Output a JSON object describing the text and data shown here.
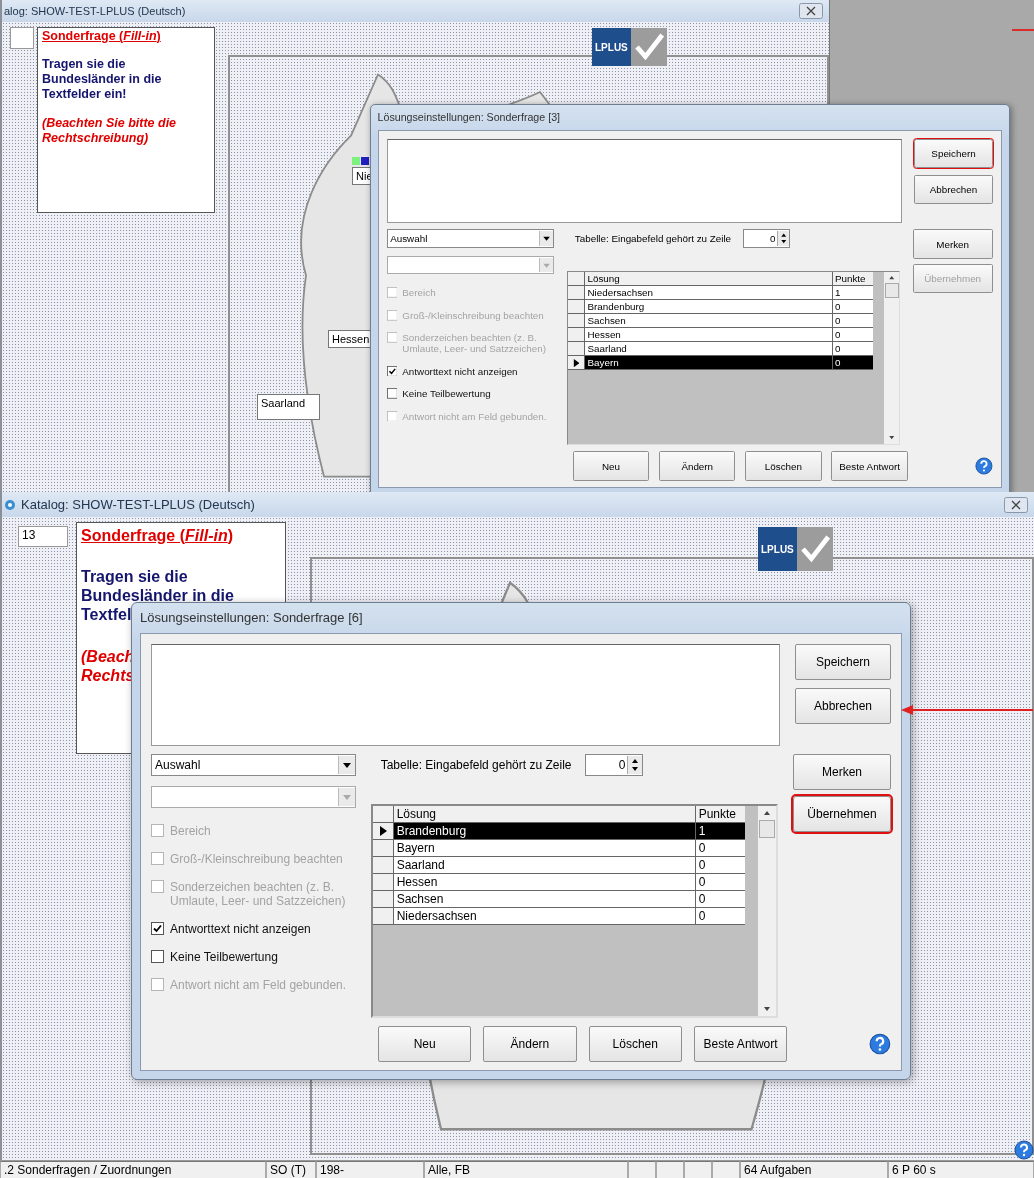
{
  "screens": [
    {
      "kind": "top",
      "title": "alog: SHOW-TEST-LPLUS (Deutsch)",
      "question": {
        "heading": "Sonderfrage (*Fill-in*)",
        "body": [
          "Tragen sie die",
          "Bundesländer in die",
          "Textfelder ein!"
        ],
        "note": [
          "(Beachten Sie bitte die",
          "Rechtschreibung)"
        ]
      },
      "logo": "LPLUS",
      "map_labels": [
        "Nie",
        "Hessen",
        "Saarland"
      ],
      "dialog": {
        "title": "Lösungseinstellungen: Sonderfrage [3]",
        "top_buttons": [
          {
            "label": "Speichern",
            "highlighted": true
          },
          {
            "label": "Abbrechen",
            "highlighted": false
          }
        ],
        "combo": "Auswahl",
        "row_label": "Tabelle: Eingabefeld gehört zu Zeile",
        "row_value": "0",
        "options": [
          {
            "label": "Bereich",
            "checked": false,
            "disabled": true
          },
          {
            "label": "Groß-/Kleinschreibung beachten",
            "checked": false,
            "disabled": true
          },
          {
            "label": "Sonderzeichen beachten (z. B. Umlaute, Leer- und Satzzeichen)",
            "checked": false,
            "disabled": true
          },
          {
            "label": "Antworttext nicht anzeigen",
            "checked": true,
            "disabled": false
          },
          {
            "label": "Keine Teilbewertung",
            "checked": false,
            "disabled": false
          },
          {
            "label": "Antwort nicht am Feld gebunden.",
            "checked": false,
            "disabled": true
          }
        ],
        "table": {
          "columns": [
            "Lösung",
            "Punkte"
          ],
          "rows": [
            {
              "cells": [
                "Niedersachsen",
                "1"
              ],
              "selected": false
            },
            {
              "cells": [
                "Brandenburg",
                "0"
              ],
              "selected": false
            },
            {
              "cells": [
                "Sachsen",
                "0"
              ],
              "selected": false
            },
            {
              "cells": [
                "Hessen",
                "0"
              ],
              "selected": false
            },
            {
              "cells": [
                "Saarland",
                "0"
              ],
              "selected": false
            },
            {
              "cells": [
                "Bayern",
                "0"
              ],
              "selected": true
            }
          ]
        },
        "side_buttons": [
          {
            "label": "Merken",
            "disabled": false,
            "highlighted": false
          },
          {
            "label": "Übernehmen",
            "disabled": true,
            "highlighted": false
          }
        ],
        "bottom_buttons": [
          "Neu",
          "Ändern",
          "Löschen",
          "Beste Antwort"
        ]
      }
    },
    {
      "kind": "bottom",
      "title": "Katalog: SHOW-TEST-LPLUS (Deutsch)",
      "number": "13",
      "question": {
        "heading": "Sonderfrage (*Fill-in*)",
        "body": [
          "Tragen sie die",
          "Bundesländer in die",
          "Textfel"
        ],
        "note": [
          "(Beach",
          "Rechts"
        ]
      },
      "logo": "LPLUS",
      "dialog": {
        "title": "Lösungseinstellungen: Sonderfrage [6]",
        "top_buttons": [
          {
            "label": "Speichern",
            "highlighted": false
          },
          {
            "label": "Abbrechen",
            "highlighted": false
          }
        ],
        "combo": "Auswahl",
        "row_label": "Tabelle: Eingabefeld gehört zu Zeile",
        "row_value": "0",
        "options": [
          {
            "label": "Bereich",
            "checked": false,
            "disabled": true
          },
          {
            "label": "Groß-/Kleinschreibung beachten",
            "checked": false,
            "disabled": true
          },
          {
            "label": "Sonderzeichen beachten (z. B. Umlaute, Leer- und Satzzeichen)",
            "checked": false,
            "disabled": true
          },
          {
            "label": "Antworttext nicht anzeigen",
            "checked": true,
            "disabled": false
          },
          {
            "label": "Keine Teilbewertung",
            "checked": false,
            "disabled": false
          },
          {
            "label": "Antwort nicht am Feld gebunden.",
            "checked": false,
            "disabled": true
          }
        ],
        "table": {
          "columns": [
            "Lösung",
            "Punkte"
          ],
          "rows": [
            {
              "cells": [
                "Brandenburg",
                "1"
              ],
              "selected": true
            },
            {
              "cells": [
                "Bayern",
                "0"
              ],
              "selected": false
            },
            {
              "cells": [
                "Saarland",
                "0"
              ],
              "selected": false
            },
            {
              "cells": [
                "Hessen",
                "0"
              ],
              "selected": false
            },
            {
              "cells": [
                "Sachsen",
                "0"
              ],
              "selected": false
            },
            {
              "cells": [
                "Niedersachsen",
                "0"
              ],
              "selected": false
            }
          ]
        },
        "side_buttons": [
          {
            "label": "Merken",
            "disabled": false,
            "highlighted": false
          },
          {
            "label": "Übernehmen",
            "disabled": false,
            "highlighted": true
          }
        ],
        "bottom_buttons": [
          "Neu",
          "Ändern",
          "Löschen",
          "Beste Antwort"
        ]
      }
    }
  ],
  "status_bar": [
    ".2 Sonderfragen / Zuordnungen",
    "SO (T)",
    "198-",
    "Alle, FB",
    "64 Aufgaben",
    "6 P 60 s"
  ]
}
